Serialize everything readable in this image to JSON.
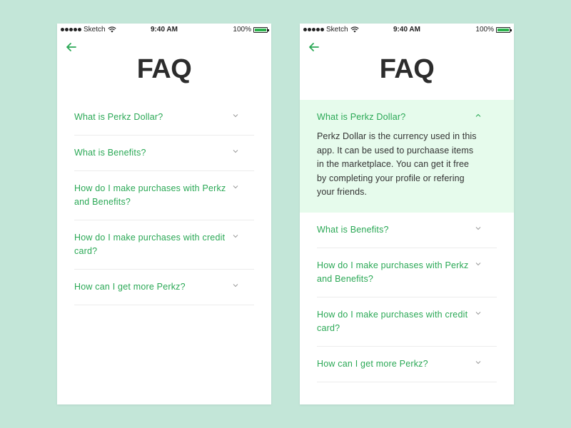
{
  "screens": [
    {
      "status": {
        "carrier": "Sketch",
        "time": "9:40 AM",
        "battery": "100%",
        "battery_level": 1.0
      },
      "title": "FAQ",
      "faqs": [
        {
          "question": "What is Perkz Dollar?",
          "expanded": false
        },
        {
          "question": "What is Benefits?",
          "expanded": false
        },
        {
          "question": "How do I make purchases with Perkz and Benefits?",
          "expanded": false
        },
        {
          "question": "How do I make purchases with credit card?",
          "expanded": false
        },
        {
          "question": "How can I get more Perkz?",
          "expanded": false
        }
      ]
    },
    {
      "status": {
        "carrier": "Sketch",
        "time": "9:40 AM",
        "battery": "100%",
        "battery_level": 1.0
      },
      "title": "FAQ",
      "faqs": [
        {
          "question": "What is Perkz Dollar?",
          "expanded": true,
          "answer": "Perkz Dollar is the currency used in this app. It can be used to purchaase items in the marketplace. You can get it free by completing your profile or refering your friends."
        },
        {
          "question": "What is Benefits?",
          "expanded": false
        },
        {
          "question": "How do I make purchases with Perkz and Benefits?",
          "expanded": false
        },
        {
          "question": "How do I make purchases with credit card?",
          "expanded": false
        },
        {
          "question": "How can I get more Perkz?",
          "expanded": false
        }
      ]
    }
  ],
  "colors": {
    "background": "#c3e6d8",
    "accent": "#2aa855",
    "expanded_bg": "#e6fbec",
    "title": "#2c2c2c"
  },
  "icons": {
    "back": "arrow-left-icon",
    "collapsed": "chevron-down-icon",
    "expanded": "chevron-up-icon",
    "wifi": "wifi-icon",
    "battery": "battery-icon"
  }
}
